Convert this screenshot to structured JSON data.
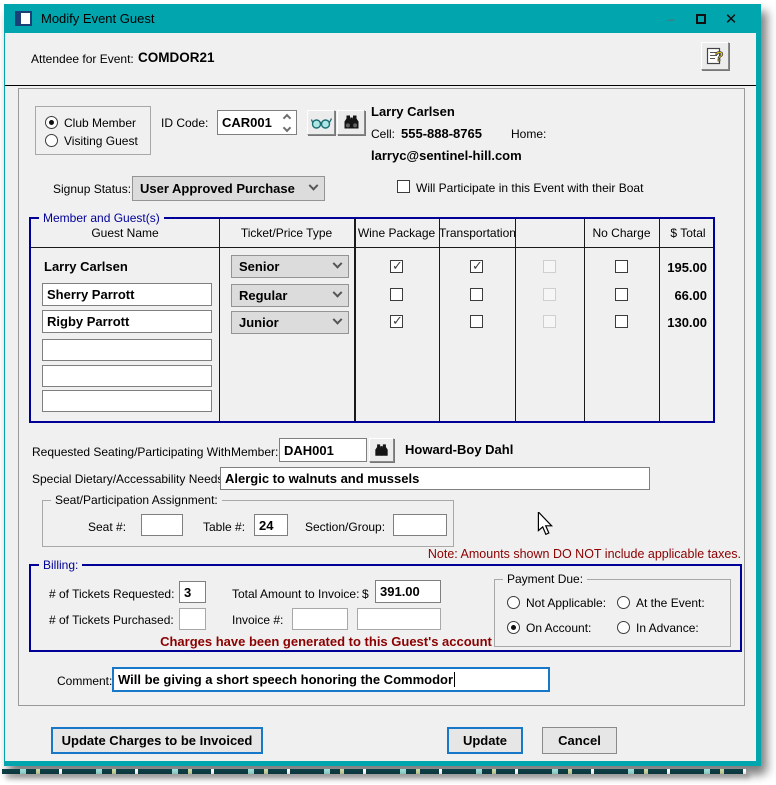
{
  "window": {
    "title": "Modify Event Guest",
    "controls": {
      "minimize_glyph": "–",
      "close_glyph": "✕"
    }
  },
  "header": {
    "attendee_label": "Attendee for Event:",
    "event_code": "COMDOR21"
  },
  "member": {
    "type_options": [
      {
        "label": "Club Member",
        "selected": true
      },
      {
        "label": "Visiting Guest",
        "selected": false
      }
    ],
    "id_code_label": "ID Code:",
    "id_code": "CAR001",
    "name": "Larry Carlsen",
    "cell_label": "Cell:",
    "cell": "555-888-8765",
    "home_label": "Home:",
    "email": "larryc@sentinel-hill.com"
  },
  "signup": {
    "label": "Signup Status:",
    "value": "User Approved Purchase",
    "boat_label": "Will Participate in this Event with their Boat",
    "boat_checked": false
  },
  "guest_table": {
    "group_label": "Member and Guest(s)",
    "columns": [
      "Guest Name",
      "Ticket/Price Type",
      "Wine Package",
      "Transportation",
      "",
      "No Charge",
      "$ Total"
    ],
    "rows": [
      {
        "name": "Larry Carlsen",
        "ticket": "Senior",
        "wine": true,
        "transportation": true,
        "blank": "disabled",
        "no_charge": false,
        "total": "195.00"
      },
      {
        "name": "Sherry Parrott",
        "ticket": "Regular",
        "wine": false,
        "transportation": false,
        "blank": "disabled",
        "no_charge": false,
        "total": "66.00"
      },
      {
        "name": "Rigby Parrott",
        "ticket": "Junior",
        "wine": true,
        "transportation": false,
        "blank": "disabled",
        "no_charge": false,
        "total": "130.00"
      }
    ],
    "empty_row_values": [
      "",
      "",
      ""
    ]
  },
  "seating": {
    "label": "Requested Seating/Participating With",
    "member_label": "Member:",
    "member_code": "DAH001",
    "member_name": "Howard-Boy Dahl"
  },
  "dietary": {
    "label": "Special Dietary/Accessability Needs:",
    "value": "Alergic to walnuts and mussels"
  },
  "assignment": {
    "group_label": "Seat/Participation Assignment:",
    "seat_label": "Seat #:",
    "seat_value": "",
    "table_label": "Table #:",
    "table_value": "24",
    "section_label": "Section/Group:",
    "section_value": ""
  },
  "note_text": "Note: Amounts shown DO NOT include applicable taxes.",
  "billing": {
    "group_label": "Billing:",
    "tickets_requested_label": "# of Tickets Requested:",
    "tickets_requested": "3",
    "total_label": "Total Amount to Invoice:",
    "dollar_sign": "$",
    "total_amount": "391.00",
    "tickets_purchased_label": "# of Tickets Purchased:",
    "tickets_purchased": "",
    "invoice_label": "Invoice #:",
    "invoice_1": "",
    "invoice_2": "",
    "charges_message": "Charges have been generated to this Guest's account",
    "payment_due": {
      "group_label": "Payment Due:",
      "options": [
        {
          "label": "Not Applicable:",
          "selected": false
        },
        {
          "label": "At the Event:",
          "selected": false
        },
        {
          "label": "On Account:",
          "selected": true
        },
        {
          "label": "In Advance:",
          "selected": false
        }
      ]
    }
  },
  "comment": {
    "label": "Comment:",
    "value": "Will be giving a short speech honoring the Commodor"
  },
  "buttons": {
    "update_charges": "Update Charges to be Invoiced",
    "update": "Update",
    "cancel": "Cancel"
  },
  "icons": {
    "window": "window-icon",
    "help": "help-question-icon",
    "eyeglasses": "eyeglasses-icon",
    "binoculars": "binoculars-icon",
    "spinner": "spinner-up-down-icon",
    "dropdown": "chevron-down-icon",
    "cursor": "arrow-cursor-icon"
  },
  "colors": {
    "titlebar_teal": "#00a5ad",
    "group_navy": "#000099",
    "warning_maroon": "#8b0000",
    "focus_blue": "#1777c8",
    "body_gray": "#f0f0f0"
  }
}
